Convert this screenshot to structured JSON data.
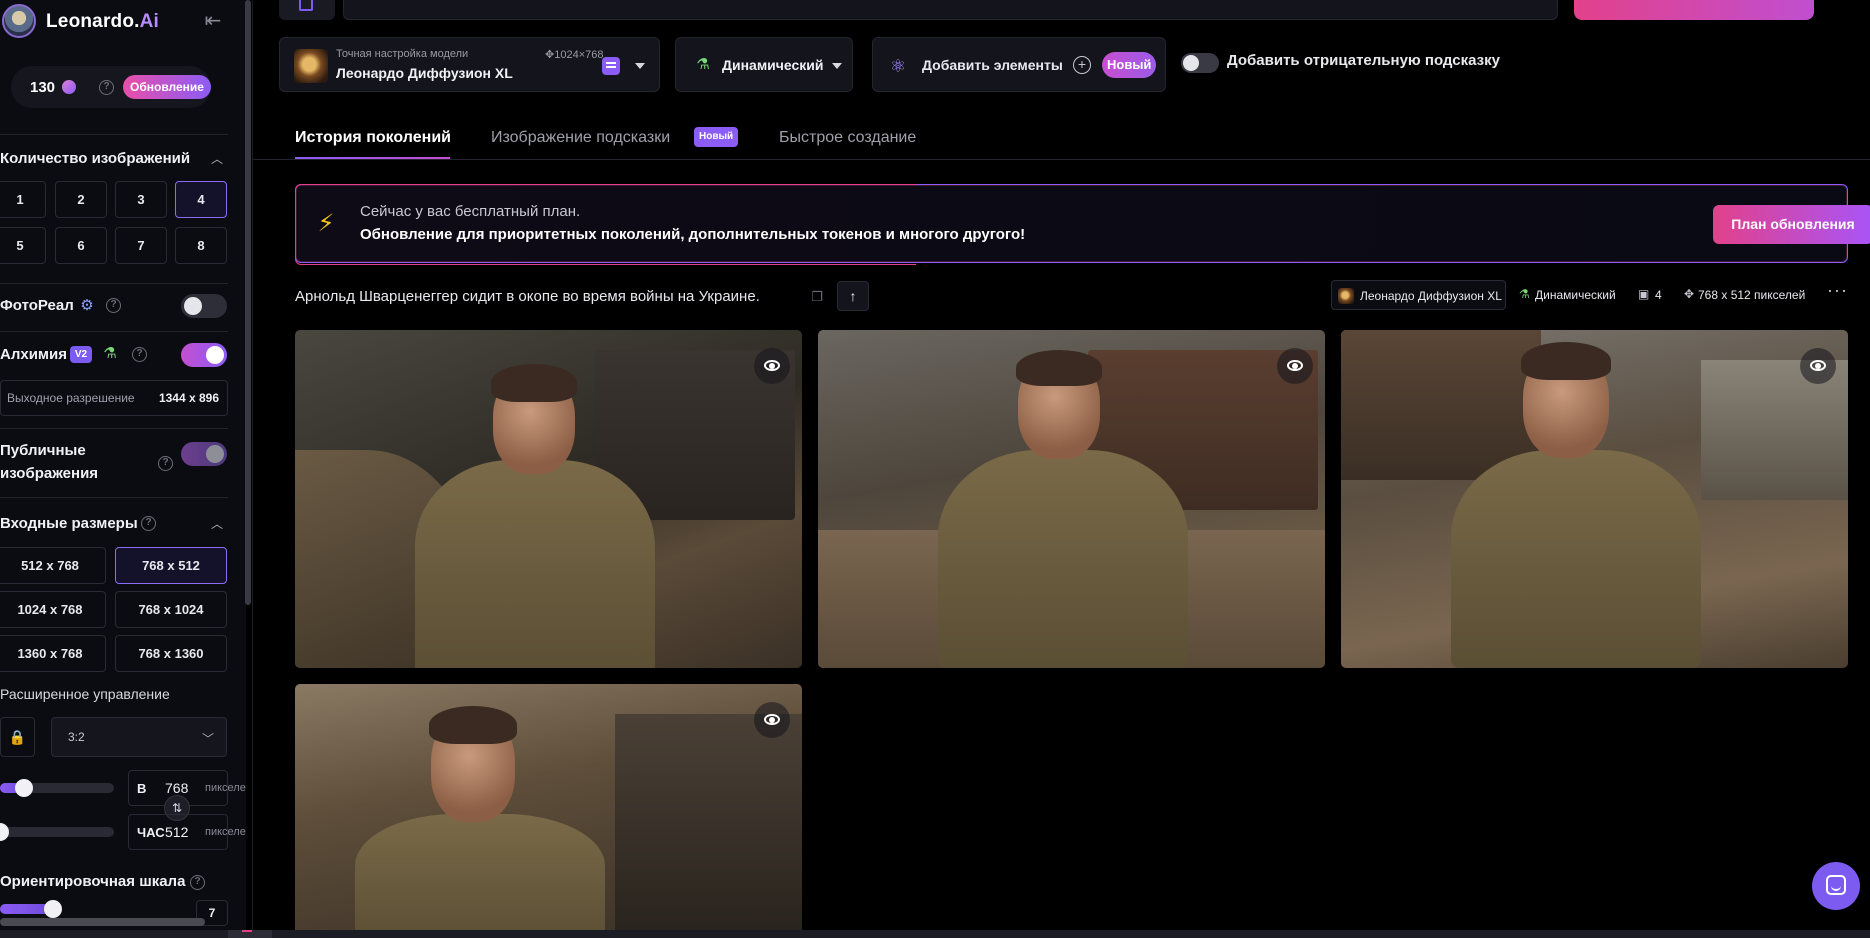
{
  "brand": {
    "name": "Leonardo.",
    "name_suffix": "Ai"
  },
  "tokens": {
    "count": "130",
    "upgrade_label": "Обновление"
  },
  "sidebar": {
    "image_count": {
      "title": "Количество изображений",
      "options": [
        "1",
        "2",
        "3",
        "4",
        "5",
        "6",
        "7",
        "8"
      ],
      "selected": "4"
    },
    "photoreal": {
      "label": "ФотоРеал",
      "enabled": false
    },
    "alchemy": {
      "label": "Алхимия",
      "badge": "V2",
      "enabled": true
    },
    "output_resolution": {
      "label": "Выходное разрешение",
      "value": "1344 x 896"
    },
    "public_images": {
      "label_line1": "Публичные",
      "label_line2": "изображения",
      "enabled": true
    },
    "input_sizes": {
      "title": "Входные размеры",
      "options": [
        "512 x 768",
        "768 x 512",
        "1024 x 768",
        "768 x 1024",
        "1360 x 768",
        "768 x 1360"
      ],
      "selected": "768 x 512"
    },
    "advanced": {
      "label": "Расширенное управление",
      "aspect_ratio": "3:2",
      "width": {
        "letter": "В",
        "value": "768",
        "unit": "пикселей",
        "level": 0.2
      },
      "height": {
        "letter": "ЧАС",
        "value": "512",
        "unit": "пикселей",
        "level": 0.0
      }
    },
    "guidance": {
      "label": "Ориентировочная шкала",
      "value": "7"
    }
  },
  "toolbar": {
    "model": {
      "caption": "Точная настройка модели",
      "size": "1024×768",
      "name": "Леонардо Диффузион XL"
    },
    "style": {
      "label": "Динамический"
    },
    "elements": {
      "label": "Добавить элементы",
      "badge": "Новый"
    },
    "negative_prompt": {
      "label": "Добавить отрицательную подсказку",
      "enabled": false
    }
  },
  "tabs": [
    {
      "label": "История поколений",
      "active": true
    },
    {
      "label": "Изображение подсказки",
      "badge": "Новый"
    },
    {
      "label": "Быстрое создание"
    }
  ],
  "banner": {
    "line1": "Сейчас у вас бесплатный план.",
    "line2": "Обновление для приоритетных поколений, дополнительных токенов и многого другого!",
    "button": "План обновления"
  },
  "generation": {
    "prompt": "Арнольд Шварценеггер сидит в окопе во время войны на Украине.",
    "model": "Леонардо Диффузион XL",
    "style": "Динамический",
    "count": "4",
    "size": "768 x 512 пикселей"
  },
  "colors": {
    "accent_purple": "#8b5cf6",
    "accent_pink": "#e2418a",
    "background": "#000000",
    "sidebar_bg": "#0b0b12"
  },
  "icons": [
    "collapse-sidebar-icon",
    "token-icon",
    "help-icon",
    "chevron-up-icon",
    "gear-icon",
    "potion-icon",
    "lock-icon",
    "chevron-down-icon",
    "swap-icon",
    "atom-icon",
    "plus-icon",
    "bolt-icon",
    "copy-icon",
    "arrow-up-icon",
    "eye-icon",
    "more-icon",
    "chat-icon"
  ]
}
